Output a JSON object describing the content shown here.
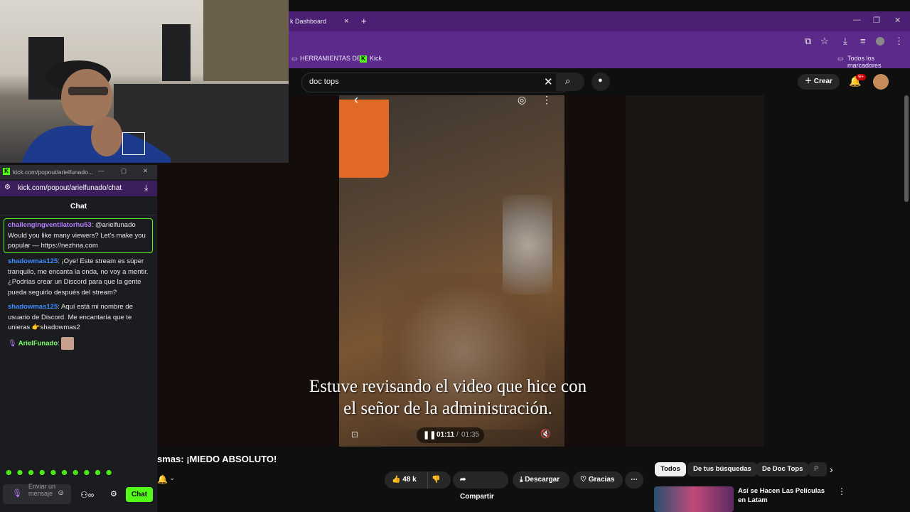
{
  "browser": {
    "tab_title": "k Dashboard",
    "tab_close": "×",
    "new_tab": "+",
    "bookmarks": [
      "HERRAMIENTAS DE...",
      "Kick"
    ],
    "all_bookmarks": "Todos los marcadores"
  },
  "youtube": {
    "search_value": "doc tops",
    "create_label": "Crear",
    "notification_count": "9+",
    "subtitle_line1": "Estuve revisando el video que hice con",
    "subtitle_line2": "el señor de la administración.",
    "time_current": "01:11",
    "time_sep": "/",
    "time_total": "01:35",
    "video_title": "smas: ¡MIEDO ABSOLUTO!",
    "like_count": "48 k",
    "share_label": "Compartir",
    "download_label": "Descargar",
    "thanks_label": "Gracias",
    "chips": [
      "Todos",
      "De tus búsquedas",
      "De Doc Tops",
      "P"
    ],
    "rec_title": "Así se Hacen Las Películas en Latam"
  },
  "kick_chat": {
    "window_title": "kick.com/popout/arielfunado...",
    "url": "kick.com/popout/arielfunado/chat",
    "header": "Chat",
    "messages": [
      {
        "user": "challengingventilatorhu53",
        "text": ": @arielfunado Would you like many viewers? Let's make you popular — https://nezhna.com"
      },
      {
        "user": "shadowmas125",
        "text": ": ¡Oye! Este stream es súper tranquilo, me encanta la onda, no voy a mentir. ¿Podrías crear un Discord para que la gente pueda seguirlo después del stream?"
      },
      {
        "user": "shadowmas125",
        "text": ": Aquí está mi nombre de usuario de Discord. Me encantaría que te unieras 👉shadowmas2"
      },
      {
        "user": "ArielFunado",
        "text": ":"
      }
    ],
    "input_placeholder": "Enviar un mensaje",
    "send_label": "Chat",
    "colors": {
      "accent": "#53fc18",
      "user_purple": "#b57cff",
      "user_blue": "#3f8cff",
      "user_green": "#7cff6b"
    }
  }
}
